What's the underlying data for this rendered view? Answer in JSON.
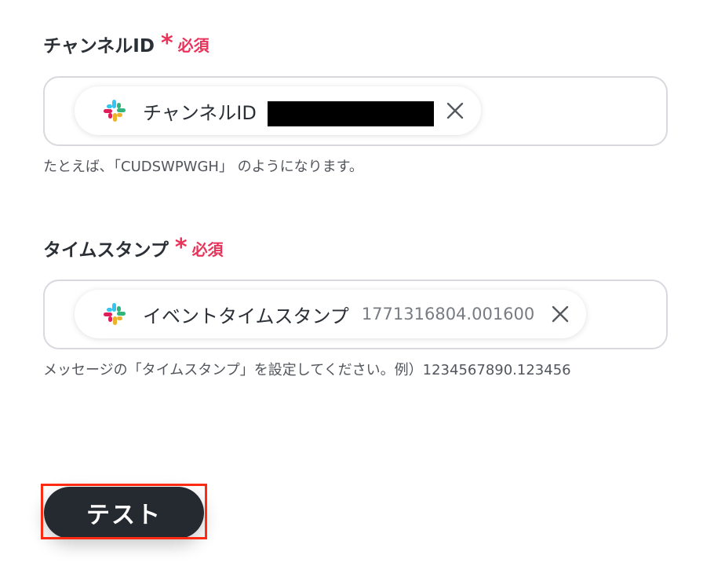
{
  "fields": [
    {
      "label": "チャンネルID",
      "required_star": "*",
      "required_text": "必須",
      "chip": {
        "icon": "slack-icon",
        "label": "チャンネルID",
        "value_redacted": true,
        "close_icon": "close-icon"
      },
      "hint": "たとえば､「CUDSWPWGH」 のようになります。"
    },
    {
      "label": "タイムスタンプ",
      "required_star": "*",
      "required_text": "必須",
      "chip": {
        "icon": "slack-icon",
        "label": "イベントタイムスタンプ",
        "value": "1771316804.001600",
        "close_icon": "close-icon"
      },
      "hint": "メッセージの「タイムスタンプ」を設定してください。例）1234567890.123456"
    }
  ],
  "test_button": {
    "label": "テスト"
  },
  "colors": {
    "required": "#e8335a",
    "button_bg": "#252a31",
    "highlight": "#ff2a12",
    "input_border": "#d7d9de"
  }
}
